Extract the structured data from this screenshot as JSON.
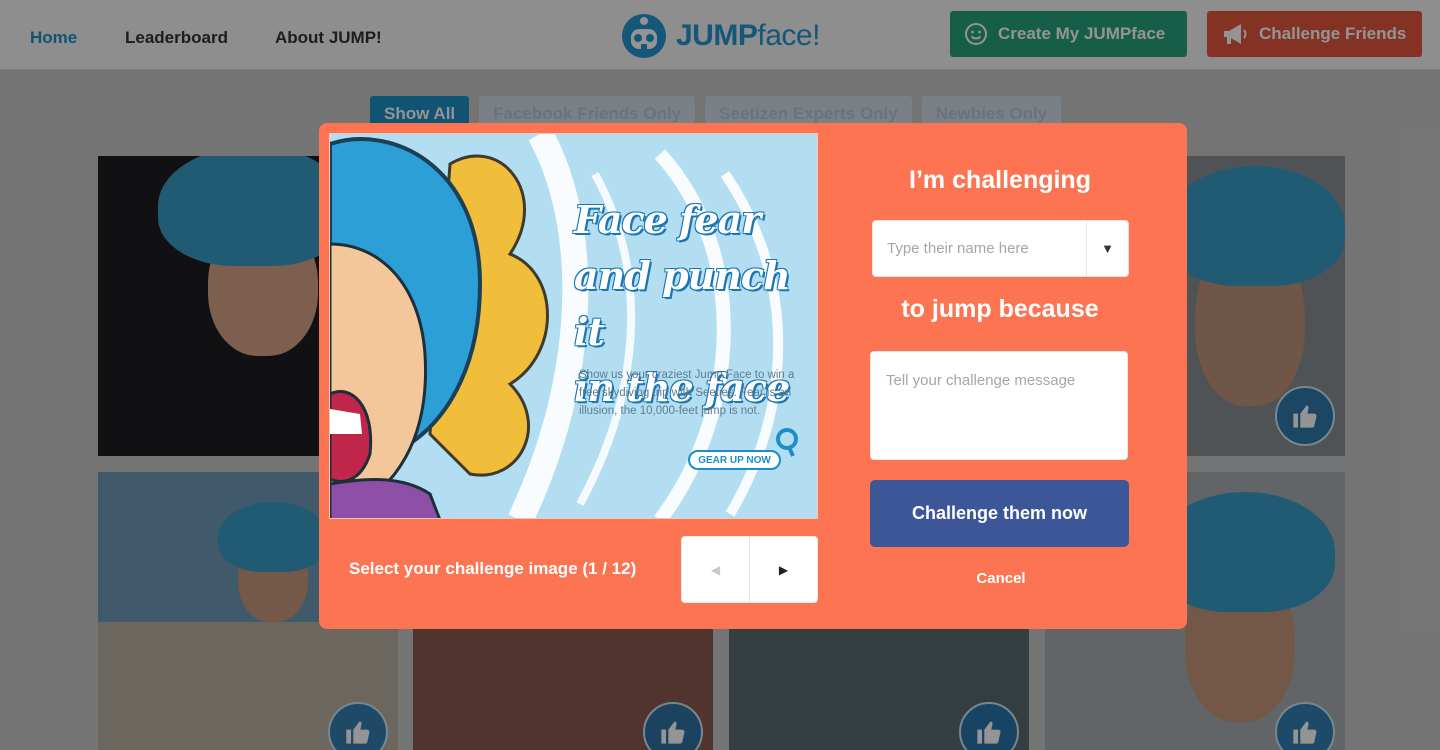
{
  "nav": {
    "items": [
      {
        "label": "Home",
        "active": true
      },
      {
        "label": "Leaderboard",
        "active": false
      },
      {
        "label": "About JUMP!",
        "active": false
      }
    ]
  },
  "logo": {
    "text_bold": "JUMP",
    "text_light": "face!"
  },
  "header_buttons": {
    "create": {
      "label": "Create My JUMPface",
      "icon": "smiley-icon",
      "color": "#27a37a"
    },
    "challenge": {
      "label": "Challenge Friends",
      "icon": "megaphone-icon",
      "color": "#e4573d"
    }
  },
  "filters": [
    {
      "label": "Show All",
      "active": true
    },
    {
      "label": "Facebook Friends Only",
      "active": false
    },
    {
      "label": "Seetizen Experts Only",
      "active": false
    },
    {
      "label": "Newbies Only",
      "active": false
    }
  ],
  "modal": {
    "poster": {
      "title_lines": [
        "Face fear",
        "and punch it",
        "in the face"
      ],
      "body": "Show us your craziest Jump Face to win a free skydiving trip with Seeties. Fear is an illusion, the 10,000-feet jump is not.",
      "cta": "GEAR UP NOW"
    },
    "select_label": "Select your challenge image (1 / 12)",
    "pager": {
      "prev": "◀",
      "next": "▶"
    },
    "heading_1": "I’m challenging",
    "name_placeholder": "Type their name here",
    "dropdown_glyph": "▼",
    "heading_2": "to jump because",
    "message_placeholder": "Tell your challenge message",
    "submit_label": "Challenge them now",
    "cancel_label": "Cancel"
  },
  "colors": {
    "modal_bg": "#fd7453",
    "submit_bg": "#3d5697",
    "brand_blue": "#1d8fc7"
  }
}
